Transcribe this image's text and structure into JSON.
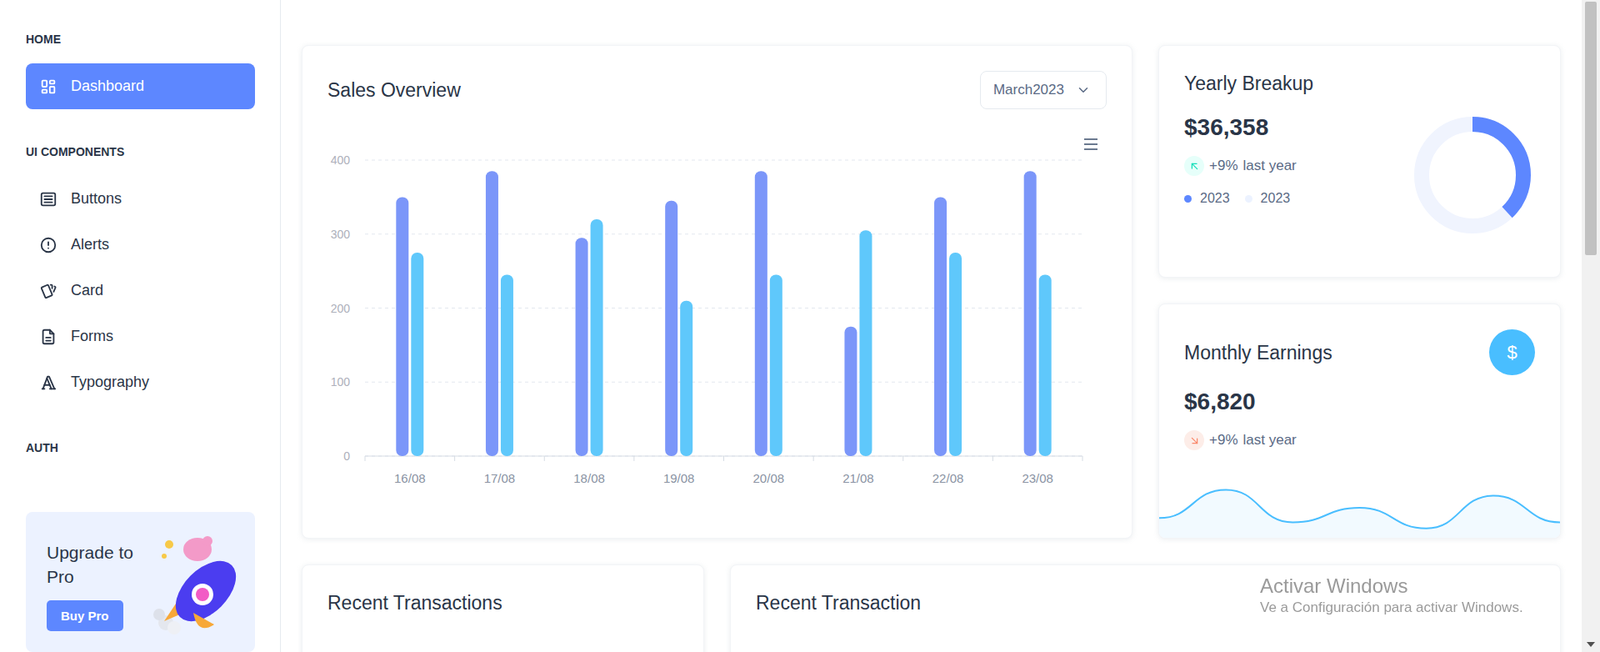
{
  "sidebar": {
    "sections": [
      {
        "title": "HOME",
        "items": [
          {
            "label": "Dashboard",
            "selected": true
          }
        ]
      },
      {
        "title": "UI COMPONENTS",
        "items": [
          {
            "label": "Buttons",
            "selected": false
          },
          {
            "label": "Alerts",
            "selected": false
          },
          {
            "label": "Card",
            "selected": false
          },
          {
            "label": "Forms",
            "selected": false
          },
          {
            "label": "Typography",
            "selected": false
          }
        ]
      },
      {
        "title": "AUTH",
        "items": []
      }
    ],
    "promo": {
      "title": "Upgrade to Pro",
      "button": "Buy Pro"
    }
  },
  "sales_overview": {
    "title": "Sales Overview",
    "period": "March2023",
    "chart": {
      "y_ticks": [
        "400",
        "300",
        "200",
        "100",
        "0"
      ],
      "x_labels": [
        "16/08",
        "17/08",
        "18/08",
        "19/08",
        "20/08",
        "21/08",
        "22/08",
        "23/08"
      ],
      "series": [
        {
          "color": "#7b96f9",
          "values": [
            350,
            385,
            295,
            345,
            385,
            175,
            350,
            385
          ]
        },
        {
          "color": "#5fc8fb",
          "values": [
            275,
            245,
            320,
            210,
            245,
            305,
            275,
            245
          ]
        }
      ]
    }
  },
  "yearly_breakup": {
    "title": "Yearly Breakup",
    "amount": "$36,358",
    "trend": "up",
    "change": "+9%",
    "change_label": "last year",
    "level": 0.38,
    "legend": [
      {
        "label": "2023",
        "color": "#5d87ff"
      },
      {
        "label": "2023",
        "color": "#ecf2ff"
      }
    ]
  },
  "monthly_earnings": {
    "title": "Monthly Earnings",
    "icon": "$",
    "amount": "$6,820",
    "trend": "down",
    "change": "+9%",
    "change_label": "last year",
    "wave": [
      23,
      56,
      18,
      35,
      11,
      49,
      18
    ]
  },
  "recent_cards": [
    {
      "title": "Recent Transactions"
    },
    {
      "title": "Recent Transaction"
    }
  ],
  "watermark": {
    "title": "Activar Windows",
    "subtitle": "Ve a Configuración para activar Windows."
  }
}
